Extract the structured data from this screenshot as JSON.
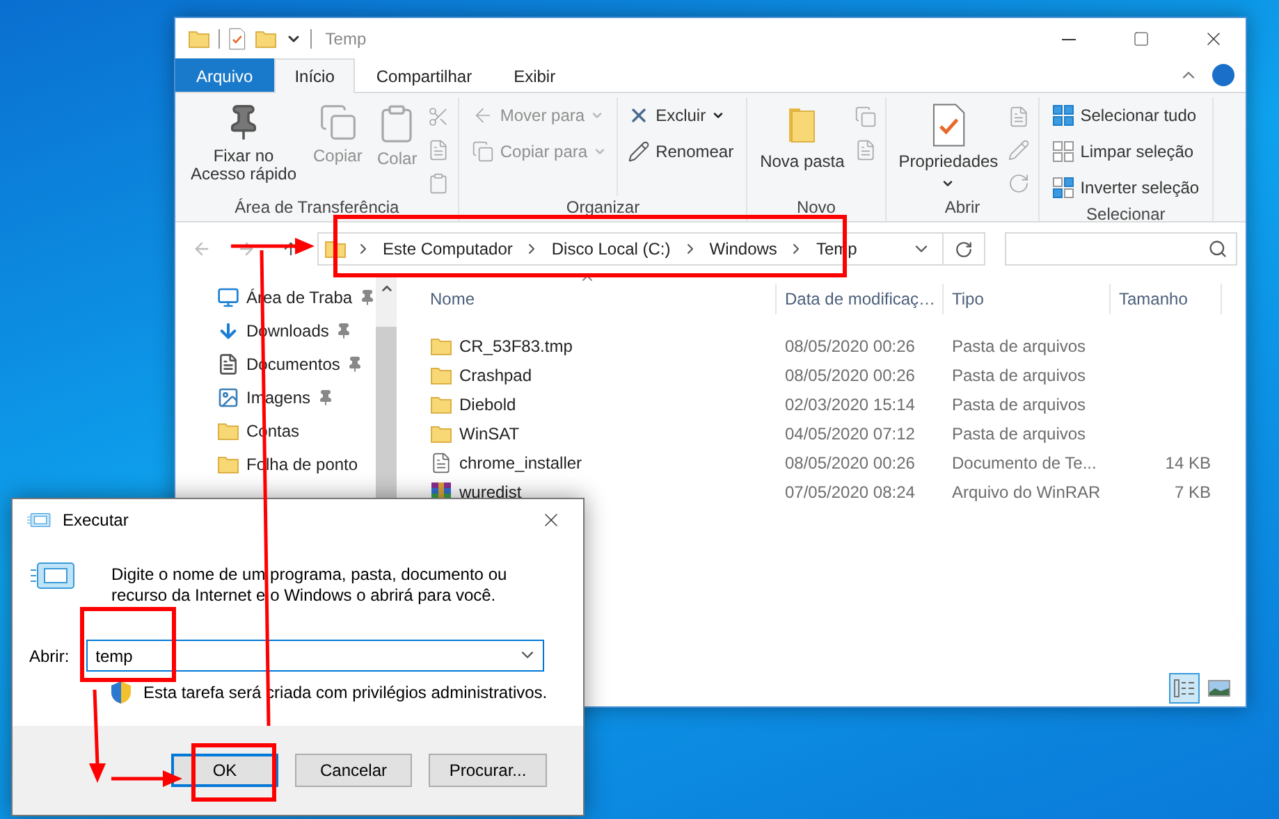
{
  "explorer": {
    "title": "Temp",
    "ribbon_tabs": [
      {
        "label": "Arquivo",
        "kind": "file",
        "selected": false
      },
      {
        "label": "Início",
        "kind": "tab",
        "selected": true
      },
      {
        "label": "Compartilhar",
        "kind": "tab",
        "selected": false
      },
      {
        "label": "Exibir",
        "kind": "tab",
        "selected": false
      }
    ],
    "ribbon_groups": [
      {
        "label": "Área de Transferência",
        "columns": [
          [
            {
              "label": "Fixar no Acesso rápido",
              "kind": "large",
              "disabled": false,
              "dropdown": false
            }
          ],
          [
            {
              "label": "Copiar",
              "kind": "large",
              "disabled": true,
              "dropdown": false
            }
          ],
          [
            {
              "label": "Colar",
              "kind": "large",
              "disabled": true,
              "dropdown": false
            }
          ]
        ]
      },
      {
        "label": "Organizar",
        "columns": [
          [
            {
              "label": "Mover para",
              "kind": "small",
              "disabled": true,
              "dropdown": true
            },
            {
              "label": "Copiar para",
              "kind": "small",
              "disabled": true,
              "dropdown": true
            }
          ],
          [
            {
              "label": "Excluir",
              "kind": "small",
              "disabled": false,
              "dropdown": true
            },
            {
              "label": "Renomear",
              "kind": "small",
              "disabled": false,
              "dropdown": false
            }
          ]
        ]
      },
      {
        "label": "Novo",
        "columns": [
          [
            {
              "label": "Nova pasta",
              "kind": "large",
              "disabled": false,
              "dropdown": false
            }
          ]
        ]
      },
      {
        "label": "Abrir",
        "columns": [
          [
            {
              "label": "Propriedades",
              "kind": "large",
              "disabled": false,
              "dropdown": true
            }
          ]
        ]
      },
      {
        "label": "Selecionar",
        "columns": [
          [
            {
              "label": "Selecionar tudo",
              "kind": "small",
              "disabled": false,
              "dropdown": false
            },
            {
              "label": "Limpar seleção",
              "kind": "small",
              "disabled": false,
              "dropdown": false
            },
            {
              "label": "Inverter seleção",
              "kind": "small",
              "disabled": false,
              "dropdown": false
            }
          ]
        ]
      }
    ],
    "address": {
      "crumbs": [
        "Este Computador",
        "Disco Local (C:)",
        "Windows",
        "Temp"
      ]
    },
    "sidebar": {
      "items": [
        {
          "label": "Área de Traba",
          "kind": "desktop",
          "pinned": true
        },
        {
          "label": "Downloads",
          "kind": "downloads",
          "pinned": true
        },
        {
          "label": "Documentos",
          "kind": "documents",
          "pinned": true
        },
        {
          "label": "Imagens",
          "kind": "pictures",
          "pinned": true
        },
        {
          "label": "Contas",
          "kind": "folder",
          "pinned": false
        },
        {
          "label": "Folha de ponto",
          "kind": "folder",
          "pinned": false
        }
      ]
    },
    "file_list": {
      "columns": [
        "Nome",
        "Data de modificaç…",
        "Tipo",
        "Tamanho"
      ],
      "rows": [
        {
          "name": "CR_53F83.tmp",
          "date": "08/05/2020 00:26",
          "type": "Pasta de arquivos",
          "size": "",
          "kind": "folder"
        },
        {
          "name": "Crashpad",
          "date": "08/05/2020 00:26",
          "type": "Pasta de arquivos",
          "size": "",
          "kind": "folder"
        },
        {
          "name": "Diebold",
          "date": "02/03/2020 15:14",
          "type": "Pasta de arquivos",
          "size": "",
          "kind": "folder"
        },
        {
          "name": "WinSAT",
          "date": "04/05/2020 07:12",
          "type": "Pasta de arquivos",
          "size": "",
          "kind": "folder"
        },
        {
          "name": "chrome_installer",
          "date": "08/05/2020 00:26",
          "type": "Documento de Te...",
          "size": "14 KB",
          "kind": "text"
        },
        {
          "name": "wuredist",
          "date": "07/05/2020 08:24",
          "type": "Arquivo do WinRAR",
          "size": "7 KB",
          "kind": "archive"
        }
      ]
    },
    "view_buttons": [
      {
        "kind": "details",
        "selected": true
      },
      {
        "kind": "large-icons",
        "selected": false
      }
    ]
  },
  "run_dialog": {
    "title": "Executar",
    "description": "Digite o nome de um programa, pasta, documento ou recurso da Internet e o Windows o abrirá para você.",
    "open_label": "Abrir:",
    "open_value": "temp",
    "admin_note": "Esta tarefa será criada com privilégios administrativos.",
    "buttons": [
      {
        "label": "OK",
        "default": true
      },
      {
        "label": "Cancelar",
        "default": false
      },
      {
        "label": "Procurar...",
        "default": false
      }
    ]
  }
}
